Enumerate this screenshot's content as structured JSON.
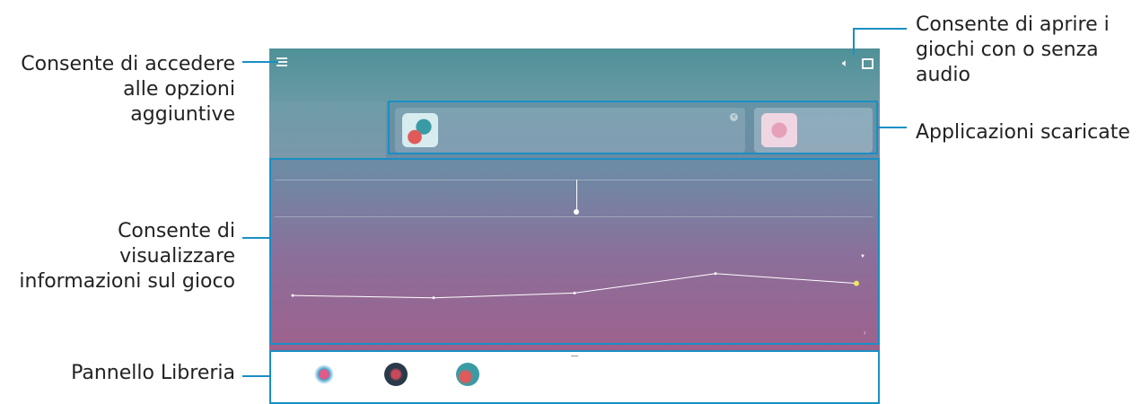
{
  "callouts": {
    "options": "Consente di accedere\nalle opzioni\naggiuntive",
    "audio": "Consente di aprire i\ngiochi con o senza\naudio",
    "downloaded": "Applicazioni scaricate",
    "info": "Consente di\nvisualizzare\ninformazioni sul gioco",
    "library": "Pannello Libreria"
  },
  "colors": {
    "leader": "#1a8fc4"
  },
  "icons": [
    "menu-icon",
    "speaker-icon",
    "cast-icon",
    "share-icon",
    "chevron-right-icon",
    "chevron-down-icon"
  ],
  "chart_data": {
    "type": "line",
    "x": [
      1,
      2,
      3,
      4,
      5
    ],
    "values": [
      0.35,
      0.3,
      0.4,
      0.8,
      0.6
    ]
  }
}
